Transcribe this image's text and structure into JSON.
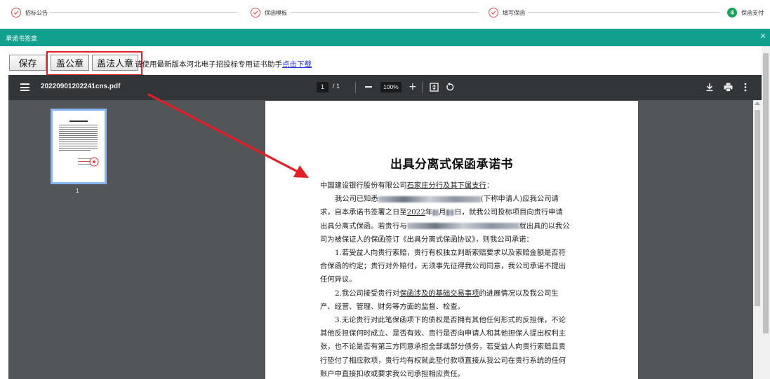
{
  "stepper": {
    "steps": [
      {
        "label": "招标公告",
        "status": "done"
      },
      {
        "label": "保函模板",
        "status": "done"
      },
      {
        "label": "填写保函",
        "status": "done"
      },
      {
        "label": "保函支付",
        "status": "active",
        "number": "4"
      }
    ]
  },
  "panel": {
    "title": "承诺书签章",
    "close_icon": "close-icon"
  },
  "toolbar": {
    "save_label": "保存",
    "company_seal_label": "盖公章",
    "legal_seal_label": "盖法人章",
    "hint_text": "请使用最新版本河北电子招投标专用证书助手",
    "hint_link": "点击下载"
  },
  "viewer": {
    "filename": "20220901202241cns.pdf",
    "current_page": "1",
    "total_pages": "/ 1",
    "zoom": "100%",
    "thumbnail_page_number": "1"
  },
  "document": {
    "title": "出具分离式保函承诺书",
    "addressee_prefix": "中国建设银行股份有限公司",
    "addressee_branch": "石家庄分行及其下属支行",
    "addressee_suffix": "：",
    "p1_a": "我公司已知悉",
    "p1_b": "(下称申请人)应我公司请",
    "p2_a": "求，自本承诺书签署之日至",
    "p2_year": "2022",
    "p2_b": "年",
    "p2_c": "月",
    "p2_d": "日，就我公司投标项目向贵行申请",
    "p3_a": "出具分离式保函。若贵行与",
    "p3_b": "就出具的以我公",
    "p4": "司为被保证人的保函签订《出具分离式保函协议》，则我公司承诺：",
    "p5": "1.若受益人向贵行索赔，贵行有权独立判断索赔要求以及索赔金额是否符",
    "p6": "合保函的约定；贵行对外赔付，无须事先征得我公司同意，我公司承诺不提出",
    "p7": "任何异议。",
    "p8_a": "2.我公司接受贵行对",
    "p8_b": "保函涉及的基础交易事项",
    "p8_c": "的进展情况以及我公司生",
    "p9": "产、经营、管理、财务等方面的监督、检查。",
    "p10": "3.无论贵行对此笔保函项下的债权是否拥有其他任何形式的反担保，不论",
    "p11": "其他反担保何时成立、是否有效、贵行是否向申请人和其他担保人提出权利主",
    "p12": "张，也不论是否有第三方同意承担全部或部分债务，若受益人向贵行索赔且贵",
    "p13": "行垫付了相应款项，贵行均有权就此垫付款项直接从我公司在贵行系统的任何",
    "p14": "账户中直接扣收或要求我公司承担相应责任。"
  },
  "colors": {
    "header_teal": "#119f8e",
    "step_done": "#e05050",
    "step_active": "#1aa35b",
    "annotation_red": "#e31e24",
    "link_blue": "#1a34d6"
  }
}
